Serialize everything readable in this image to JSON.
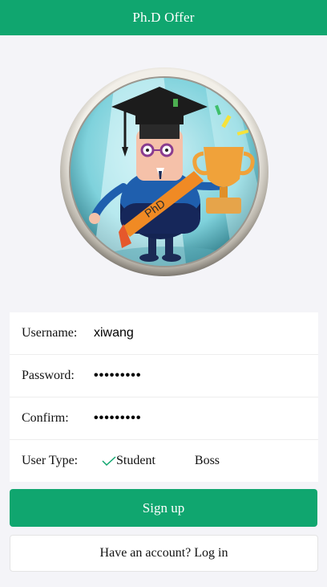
{
  "header": {
    "title": "Ph.D  Offer"
  },
  "avatar": {
    "icon": "phd-graduate-avatar",
    "sash_text": "PhD"
  },
  "form": {
    "username": {
      "label": "Username:",
      "value": "xiwang"
    },
    "password": {
      "label": "Password:",
      "value": "•••••••••"
    },
    "confirm": {
      "label": "Confirm:",
      "value": "•••••••••"
    },
    "user_type": {
      "label": "User  Type:",
      "options": [
        "Student",
        "Boss"
      ],
      "selected": "Student"
    }
  },
  "buttons": {
    "signup": "Sign up",
    "login": "Have an account? Log in"
  },
  "colors": {
    "accent": "#10a66f",
    "background": "#f4f4f8"
  }
}
